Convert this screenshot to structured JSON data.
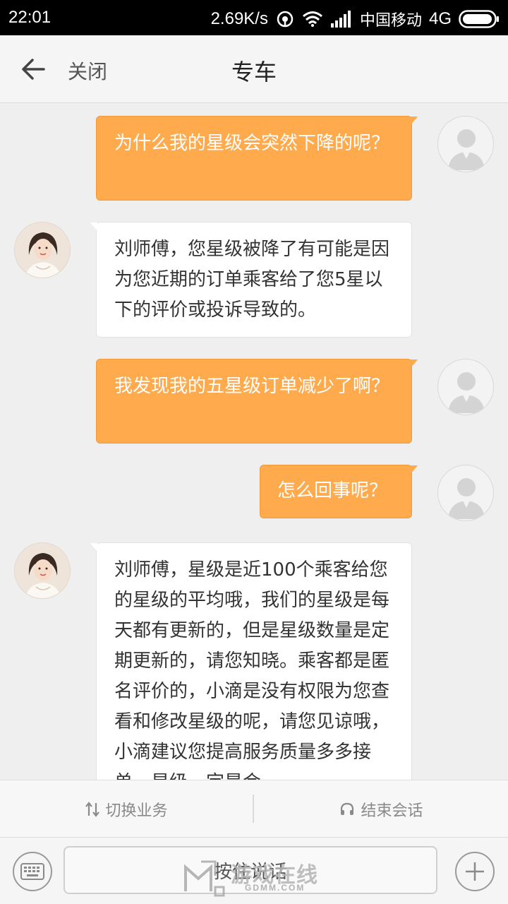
{
  "status_bar": {
    "time": "22:01",
    "speed": "2.69K/s",
    "carrier": "中国移动",
    "network": "4G",
    "icons": [
      "sync-icon",
      "wifi-icon",
      "signal-icon",
      "battery-icon"
    ]
  },
  "header": {
    "close_label": "关闭",
    "title": "专车"
  },
  "messages": [
    {
      "side": "out",
      "text": "为什么我的星级会突然下降的呢？"
    },
    {
      "side": "in",
      "text": "刘师傅，您星级被降了有可能是因为您近期的订单乘客给了您5星以下的评价或投诉导致的。"
    },
    {
      "side": "out",
      "text": "我发现我的五星级订单减少了啊？"
    },
    {
      "side": "out",
      "text": "怎么回事呢？"
    },
    {
      "side": "in",
      "text": "刘师傅，星级是近100个乘客给您的星级的平均哦，我们的星级是每天都有更新的，但是星级数量是定期更新的，请您知晓。乘客都是匿名评价的，小滴是没有权限为您查看和修改星级的呢，请您见谅哦，小滴建议您提高服务质量多多接单，星级一定是会"
    }
  ],
  "action_bar": {
    "switch_label": "切换业务",
    "end_label": "结束会话"
  },
  "input_bar": {
    "hold_label": "按住说话"
  },
  "watermark": {
    "text": "游戏在线",
    "sub": "GDMM.COM"
  },
  "colors": {
    "outgoing_bubble": "#ffaa4d",
    "incoming_bubble": "#ffffff",
    "background": "#efefef"
  }
}
